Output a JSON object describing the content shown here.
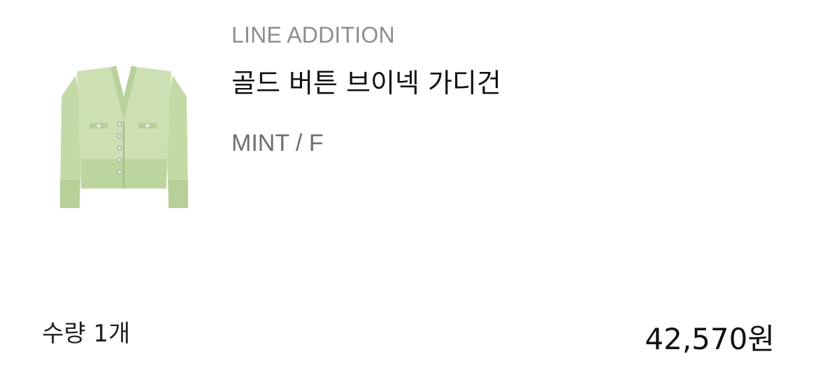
{
  "product": {
    "brand": "LINE ADDITION",
    "name": "골드 버튼 브이넥 가디건",
    "option": "MINT / F",
    "image_alt": "mint-cardigan-image",
    "color": "#c9dcae"
  },
  "summary": {
    "quantity": "수량 1개",
    "price": "42,570원"
  }
}
